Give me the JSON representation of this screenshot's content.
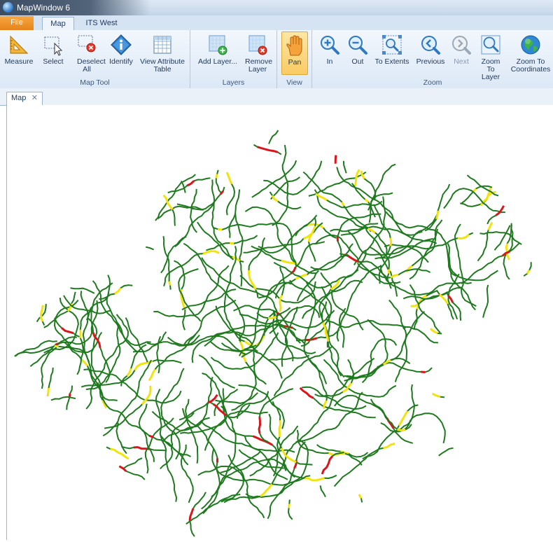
{
  "window": {
    "title": "MapWindow 6"
  },
  "tabs": [
    {
      "label": "File"
    },
    {
      "label": "Map"
    },
    {
      "label": "ITS West"
    }
  ],
  "ribbon": {
    "groups": [
      {
        "label": "Map Tool"
      },
      {
        "label": "Layers"
      },
      {
        "label": "View"
      },
      {
        "label": "Zoom"
      }
    ],
    "buttons": {
      "measure": "Measure",
      "select": "Select",
      "deselect": "Deselect All",
      "identify": "Identify",
      "attribute_table": "View Attribute Table",
      "add_layer": "Add Layer...",
      "remove_layer": "Remove Layer",
      "pan": "Pan",
      "zoom_in": "In",
      "zoom_out": "Out",
      "to_extents": "To Extents",
      "previous": "Previous",
      "next": "Next",
      "zoom_to_layer": "Zoom To Layer",
      "zoom_to_coordinates": "Zoom To Coordinates"
    }
  },
  "document_tab": {
    "label": "Map",
    "close": "✕"
  },
  "map": {
    "colors": {
      "normal": "#1f7a1f",
      "slow": "#f2e30f",
      "jam": "#d9161c"
    }
  }
}
